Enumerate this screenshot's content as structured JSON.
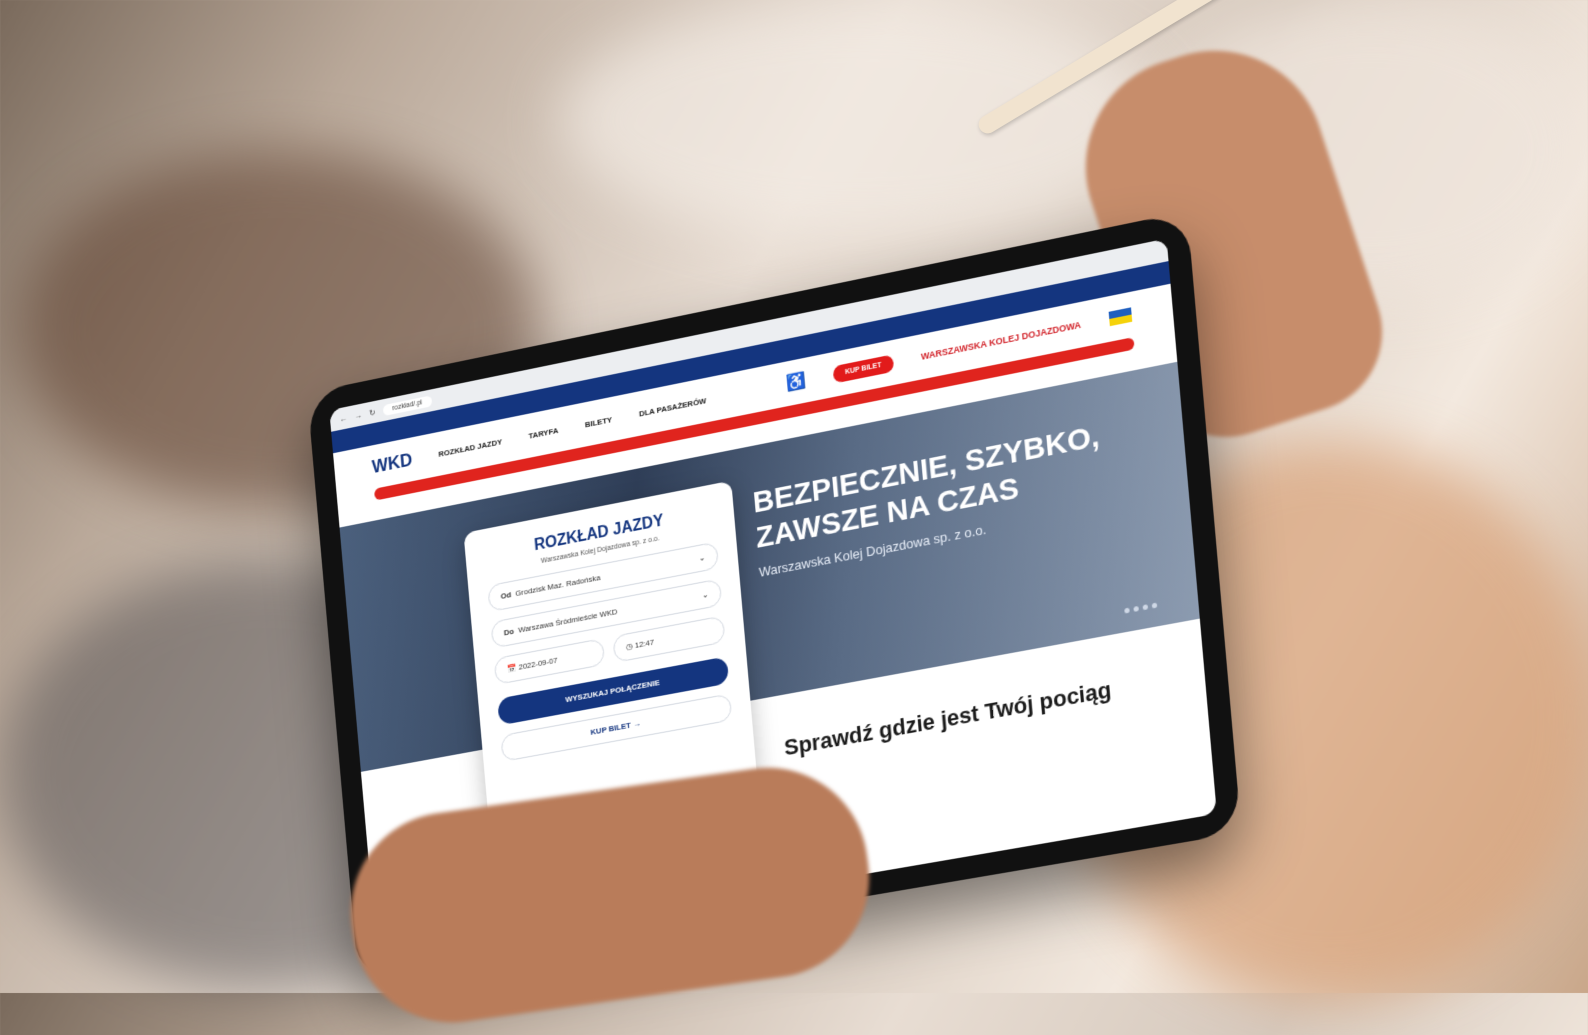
{
  "browser": {
    "url": "rozkład/.pl"
  },
  "top_nav": [],
  "main_nav": {
    "logo_text": "WKD",
    "items": [
      "ROZKŁAD JAZDY",
      "TARYFA",
      "BILETY",
      "DLA PASAŻERÓW"
    ],
    "buy_label": "KUP BILET",
    "partner_label": "WARSZAWSKA KOLEJ DOJAZDOWA"
  },
  "alert_text": "",
  "hero": {
    "title_line1": "BEZPIECZNIE, SZYBKO,",
    "title_line2": "ZAWSZE NA CZAS",
    "subtitle": "Warszawska Kolej Dojazdowa sp. z o.o."
  },
  "search_card": {
    "title": "ROZKŁAD JAZDY",
    "caption": "Warszawska Kolej Dojazdowa sp. z o.o.",
    "from_label": "Od",
    "from_value": "Grodzisk Maz. Radońska",
    "to_label": "Do",
    "to_value": "Warszawa Śródmieście WKD",
    "date_value": "2022-09-07",
    "time_value": "12:47",
    "search_button": "WYSZUKAJ POŁĄCZENIE",
    "buy_button": "KUP BILET"
  },
  "section": {
    "title": "Sprawdź gdzie jest Twój pociąg",
    "subtitle": ""
  }
}
